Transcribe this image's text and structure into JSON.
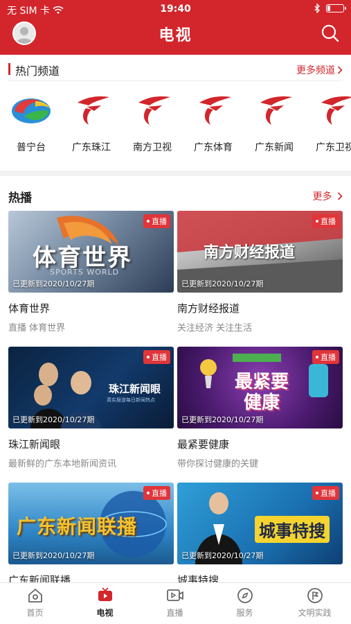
{
  "status_bar": {
    "carrier": "无 SIM 卡",
    "time": "19:40",
    "battery_level": 0.2
  },
  "header": {
    "title": "电视",
    "avatar_icon": "avatar-icon",
    "search_icon": "search-icon"
  },
  "hot_channels": {
    "label": "热门频道",
    "more_label": "更多频道",
    "items": [
      {
        "name": "普宁台",
        "icon": "puning-logo"
      },
      {
        "name": "广东珠江",
        "icon": "gdtv-logo"
      },
      {
        "name": "南方卫视",
        "icon": "gdtv-logo"
      },
      {
        "name": "广东体育",
        "icon": "gdtv-logo"
      },
      {
        "name": "广东新闻",
        "icon": "gdtv-logo"
      },
      {
        "name": "广东卫视",
        "icon": "gdtv-logo"
      }
    ]
  },
  "hot_play": {
    "label": "热播",
    "more_label": "更多",
    "live_badge": "直播",
    "cards": [
      {
        "title": "体育世界",
        "subtitle": "直播 体育世界",
        "updated": "已更新到2020/10/27期",
        "thumb_text": "体育世界",
        "thumb_sub": "SPORTS WORLD"
      },
      {
        "title": "南方财经报道",
        "subtitle": "关注经济 关注生活",
        "updated": "已更新到2020/10/27期",
        "thumb_text": "南方财经报道",
        "thumb_sub": ""
      },
      {
        "title": "珠江新闻眼",
        "subtitle": "最新鲜的广东本地新闻资讯",
        "updated": "已更新到2020/10/27期",
        "thumb_text": "珠江新闻眼",
        "thumb_sub": "真实报道每日新闻热点"
      },
      {
        "title": "最紧要健康",
        "subtitle": "带你探讨健康的关键",
        "updated": "已更新到2020/10/27期",
        "thumb_text": "最紧要健康",
        "thumb_sub": ""
      },
      {
        "title": "广东新闻联播",
        "subtitle": "",
        "updated": "已更新到2020/10/27期",
        "thumb_text": "广东新闻联播",
        "thumb_sub": ""
      },
      {
        "title": "城事特搜",
        "subtitle": "",
        "updated": "已更新到2020/10/27期",
        "thumb_text": "城事特搜",
        "thumb_sub": ""
      }
    ]
  },
  "tabbar": {
    "items": [
      {
        "label": "首页",
        "icon": "home-icon",
        "active": false
      },
      {
        "label": "电视",
        "icon": "tv-icon",
        "active": true
      },
      {
        "label": "直播",
        "icon": "live-video-icon",
        "active": false
      },
      {
        "label": "服务",
        "icon": "compass-icon",
        "active": false
      },
      {
        "label": "文明实践",
        "icon": "flag-badge-icon",
        "active": false
      }
    ]
  },
  "colors": {
    "brand_red": "#d2262c",
    "muted_text": "#888888"
  }
}
